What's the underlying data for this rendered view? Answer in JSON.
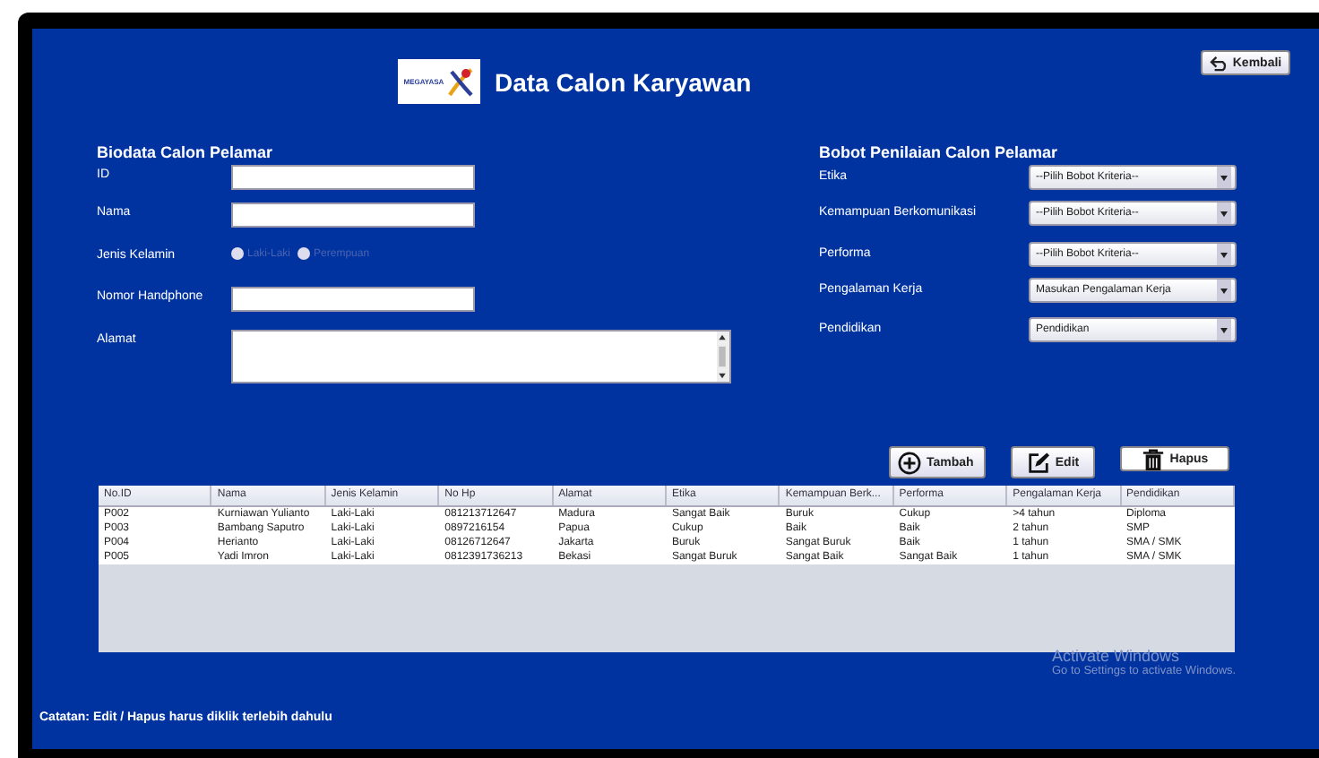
{
  "header": {
    "logo_text": "MEGAYASA",
    "title": "Data Calon Karyawan",
    "back_button": "Kembali"
  },
  "biodata": {
    "heading": "Biodata Calon Pelamar",
    "fields": [
      {
        "kind": "text",
        "label": "ID"
      },
      {
        "kind": "text",
        "label": "Nama"
      },
      {
        "kind": "radio",
        "label": "Jenis Kelamin",
        "options": [
          {
            "label": "Laki-Laki",
            "selected": false
          },
          {
            "label": "Perempuan",
            "selected": false
          }
        ]
      },
      {
        "kind": "text",
        "label": "Nomor Handphone"
      },
      {
        "kind": "textarea",
        "label": "Alamat"
      }
    ]
  },
  "bobot": {
    "heading": "Bobot Penilaian Calon Pelamar",
    "fields": [
      {
        "label": "Etika",
        "value": "--Pilih Bobot Kriteria--"
      },
      {
        "label": "Kemampuan Berkomunikasi",
        "value": "--Pilih Bobot Kriteria--"
      },
      {
        "label": "Performa",
        "value": "--Pilih Bobot Kriteria--"
      },
      {
        "label": "Pengalaman Kerja",
        "value": "Masukan Pengalaman Kerja"
      },
      {
        "label": "Pendidikan",
        "value": "Pendidikan"
      }
    ]
  },
  "actions": [
    {
      "kind": "add",
      "label": "Tambah"
    },
    {
      "kind": "edit",
      "label": "Edit"
    },
    {
      "kind": "delete",
      "label": "Hapus"
    }
  ],
  "table": {
    "columns": [
      "No.ID",
      "Nama",
      "Jenis Kelamin",
      "No Hp",
      "Alamat",
      "Etika",
      "Kemampuan Berk...",
      "Performa",
      "Pengalaman Kerja",
      "Pendidikan"
    ],
    "rows": [
      [
        "P002",
        "Kurniawan Yulianto",
        "Laki-Laki",
        "081213712647",
        "Madura",
        "Sangat Baik",
        "Buruk",
        "Cukup",
        ">4 tahun",
        "Diploma"
      ],
      [
        "P003",
        "Bambang Saputro",
        "Laki-Laki",
        "0897216154",
        "Papua",
        "Cukup",
        "Baik",
        "Baik",
        "2 tahun",
        "SMP"
      ],
      [
        "P004",
        "Herianto",
        "Laki-Laki",
        "08126712647",
        "Jakarta",
        "Buruk",
        "Sangat Buruk",
        "Baik",
        "1 tahun",
        "SMA / SMK"
      ],
      [
        "P005",
        "Yadi Imron",
        "Laki-Laki",
        "0812391736213",
        "Bekasi",
        "Sangat Buruk",
        "Sangat Baik",
        "Sangat Baik",
        "1 tahun",
        "SMA / SMK"
      ]
    ]
  },
  "activation": {
    "title": "Activate Windows",
    "subtitle": "Go to Settings to activate Windows."
  },
  "note": "Catatan: Edit / Hapus harus diklik terlebih dahulu"
}
